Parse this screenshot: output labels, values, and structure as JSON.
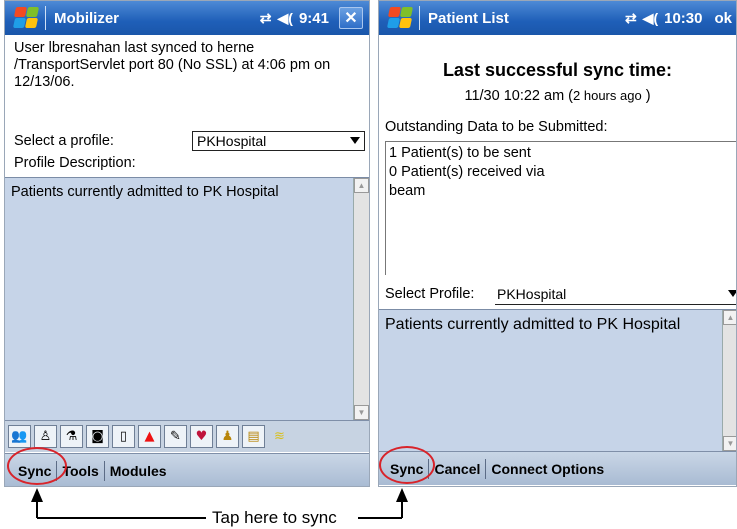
{
  "left": {
    "title": "Mobilizer",
    "time": "9:41",
    "message": "User lbresnahan last synced to herne /TransportServlet port 80 (No SSL) at 4:06 pm on 12/13/06.",
    "select_profile_label": "Select a profile:",
    "profile_value": "PKHospital",
    "profile_description_label": "Profile Description:",
    "description": "Patients currently admitted to PK Hospital",
    "menu": [
      "Sync",
      "Tools",
      "Modules"
    ],
    "toolbar_icons": [
      "people-icon",
      "person-dropdown-icon",
      "flask-icon",
      "camera-icon",
      "clipboard-icon",
      "alert-triangle-icon",
      "pills-icon",
      "heart-icon",
      "patient-icon",
      "notes-icon",
      "sync-status-icon"
    ]
  },
  "right": {
    "title": "Patient List",
    "time": "10:30",
    "ok_label": "ok",
    "last_sync_title": "Last successful sync time:",
    "last_sync_time": "11/30 10:22 am (",
    "last_sync_ago": "2 hours ago",
    "last_sync_close": " )",
    "outstanding_label": "Outstanding Data to be Submitted:",
    "outstanding_lines": [
      "1 Patient(s) to be sent",
      "0 Patient(s) received via beam"
    ],
    "select_profile_label": "Select Profile:",
    "profile_value": "PKHospital",
    "description": "Patients currently admitted to PK Hospital",
    "menu": [
      "Sync",
      "Cancel",
      "Connect Options"
    ]
  },
  "callout_text": "Tap here to sync",
  "colors": {
    "titlebar": "#1f5fb8",
    "description_bg": "#c6d4e8",
    "highlight_circle": "#d8232a"
  }
}
